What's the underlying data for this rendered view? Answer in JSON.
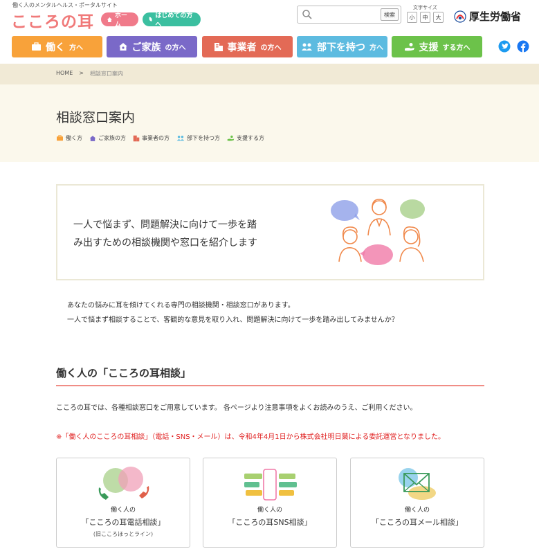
{
  "header": {
    "tagline": "働く人のメンタルヘルス・ポータルサイト",
    "logo": "こころの耳",
    "home_label": "ホーム",
    "first_label": "はじめての方へ",
    "search_button": "検索",
    "search_placeholder": "",
    "font_size_label": "文字サイズ",
    "font_sizes": [
      "小",
      "中",
      "大"
    ],
    "ministry": "厚生労働省"
  },
  "nav": [
    {
      "main": "働く",
      "suffix": "方へ"
    },
    {
      "main": "ご家族",
      "suffix": "の方へ"
    },
    {
      "main": "事業者",
      "suffix": "の方へ"
    },
    {
      "main": "部下を持つ",
      "suffix": "方へ"
    },
    {
      "main": "支援",
      "suffix": "する方へ"
    }
  ],
  "breadcrumb": {
    "home": "HOME",
    "sep": ">",
    "current": "相談窓口案内"
  },
  "page": {
    "title": "相談窓口案内",
    "categories": [
      "働く方",
      "ご家族の方",
      "事業者の方",
      "部下を持つ方",
      "支援する方"
    ]
  },
  "intro": {
    "line1": "一人で悩まず、問題解決に向けて一歩を踏",
    "line2": "み出すための相談機関や窓口を紹介します"
  },
  "description": {
    "line1": "あなたの悩みに耳を傾けてくれる専門の相談機関・相談窓口があります。",
    "line2": "一人で悩まず相談することで、客観的な意見を取り入れ、問題解決に向けて一歩を踏み出してみませんか？"
  },
  "section": {
    "title": "働く人の「こころの耳相談」",
    "desc": "こころの耳では、各種相談窓口をご用意しています。 各ページより注意事項をよくお読みのうえ、ご利用ください。",
    "notice": "※「働く人のこころの耳相談」（電話・SNS・メール）は、令和4年4月1日から株式会社明日葉による委託運営となりました。"
  },
  "cards": [
    {
      "line1": "働く人の",
      "line2": "「こころの耳電話相談」",
      "line3": "(旧こころほっとライン)"
    },
    {
      "line1": "働く人の",
      "line2": "「こころの耳SNS相談」",
      "line3": ""
    },
    {
      "line1": "働く人の",
      "line2": "「こころの耳メール相談」",
      "line3": ""
    }
  ],
  "colors": {
    "nav_work": "#f8a23a",
    "nav_family": "#7a69c8",
    "nav_business": "#e36a56",
    "nav_manager": "#5dbbe0",
    "nav_support": "#6cc24a",
    "logo": "#f07a7a",
    "notice": "#e02020"
  },
  "icons": {
    "search": "search-icon",
    "twitter": "twitter-icon",
    "facebook": "facebook-icon"
  }
}
